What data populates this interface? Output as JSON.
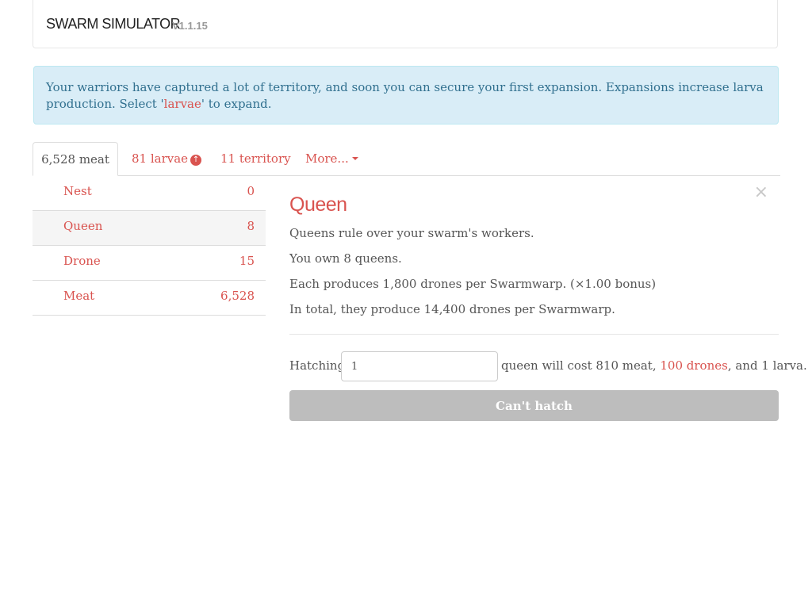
{
  "navbar": {
    "brand": "SWARM SIMULATOR",
    "version": "V1.1.15"
  },
  "alert": {
    "text_before": "Your warriors have captured a lot of territory, and soon you can secure your first expansion. Expansions increase larva production. Select '",
    "link": "larvae",
    "text_after": "' to expand."
  },
  "tabs": [
    {
      "label": "6,528 meat",
      "active": true
    },
    {
      "label": "81 larvae",
      "icon": "upgrade-arrow-icon"
    },
    {
      "label": "11 territory"
    },
    {
      "label": "More...",
      "icon": "caret-down-icon"
    }
  ],
  "units": [
    {
      "name": "Nest",
      "count": "0"
    },
    {
      "name": "Queen",
      "count": "8",
      "selected": true
    },
    {
      "name": "Drone",
      "count": "15"
    },
    {
      "name": "Meat",
      "count": "6,528"
    }
  ],
  "detail": {
    "close": "×",
    "title": "Queen",
    "description": "Queens rule over your swarm's workers.",
    "owned": "You own 8 queens.",
    "produces": "Each produces 1,800 drones per Swarmwarp. (×1.00 bonus)",
    "total": "In total, they produce 14,400 drones per Swarmwarp.",
    "hatch_label": "Hatching",
    "hatch_value": "1",
    "cost_before": "queen will cost 810 meat, ",
    "cost_link": "100 drones",
    "cost_after": ", and 1 larva.",
    "button": "Can't hatch"
  },
  "colors": {
    "accent": "#d9534f",
    "alert_bg": "#d9edf7",
    "disabled_button": "#bdbdbd"
  }
}
